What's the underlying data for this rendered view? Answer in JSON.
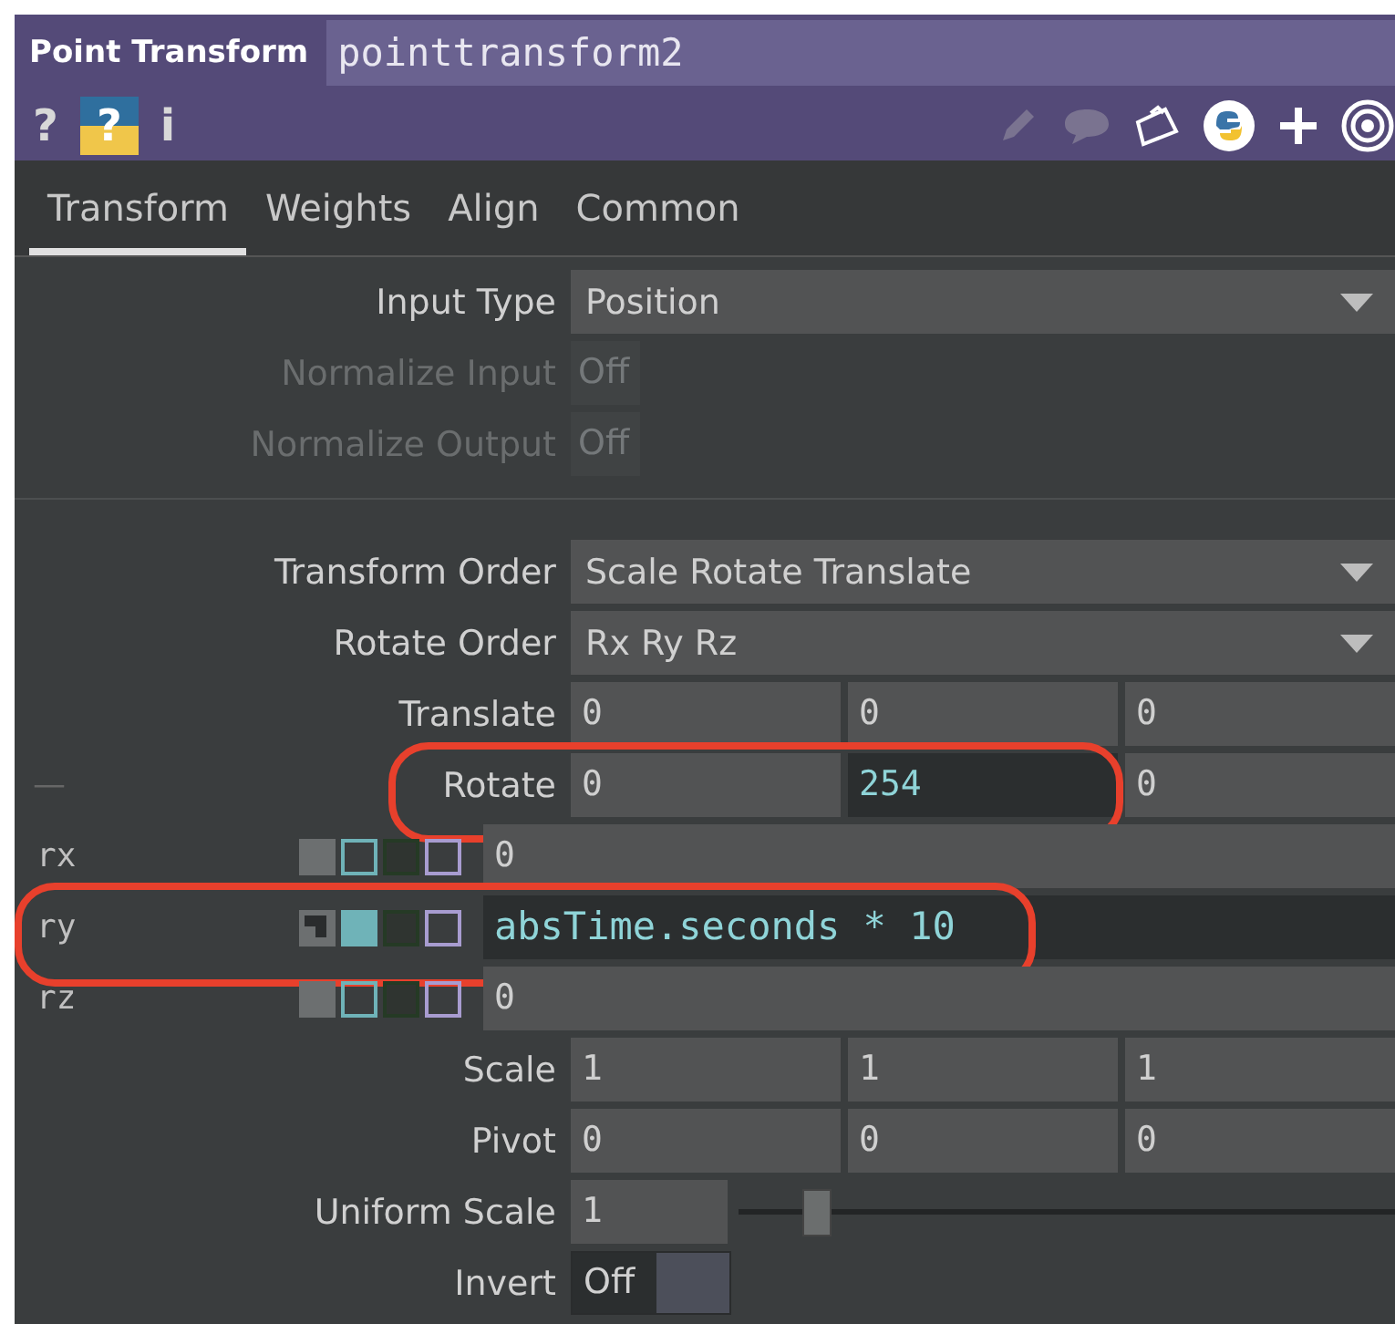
{
  "header": {
    "op_type": "Point Transform",
    "name": "pointtransform2"
  },
  "help_buttons": [
    {
      "kind": "plain",
      "label": "?"
    },
    {
      "kind": "badge",
      "label": "?"
    },
    {
      "kind": "plain",
      "label": "i"
    }
  ],
  "tabs": [
    {
      "label": "Transform",
      "selected": true
    },
    {
      "label": "Weights",
      "selected": false
    },
    {
      "label": "Align",
      "selected": false
    },
    {
      "label": "Common",
      "selected": false
    }
  ],
  "params": [
    {
      "kind": "menu",
      "label": "Input Type",
      "value": "Position"
    },
    {
      "kind": "toggle",
      "label": "Normalize Input",
      "value": "Off",
      "disabled": true
    },
    {
      "kind": "toggle",
      "label": "Normalize Output",
      "value": "Off",
      "disabled": true
    },
    {
      "kind": "separator"
    },
    {
      "kind": "menu",
      "label": "Transform Order",
      "value": "Scale Rotate Translate"
    },
    {
      "kind": "menu",
      "label": "Rotate Order",
      "value": "Rx Ry Rz"
    },
    {
      "kind": "vector",
      "label": "Translate",
      "highlighted": false,
      "values": [
        {
          "text": "0",
          "expression": false
        },
        {
          "text": "0",
          "expression": false
        },
        {
          "text": "0",
          "expression": false
        }
      ]
    },
    {
      "kind": "vector",
      "label": "Rotate",
      "side_mark": "—",
      "highlighted": true,
      "values": [
        {
          "text": "0",
          "expression": false
        },
        {
          "text": "254",
          "expression": true
        },
        {
          "text": "0",
          "expression": false
        }
      ]
    },
    {
      "kind": "channel",
      "label": "rx",
      "expression": false,
      "value": "0",
      "highlighted": false
    },
    {
      "kind": "channel",
      "label": "ry",
      "expression": true,
      "value": "absTime.seconds * 10",
      "highlighted": true
    },
    {
      "kind": "channel",
      "label": "rz",
      "expression": false,
      "value": "0",
      "highlighted": false
    },
    {
      "kind": "vector",
      "label": "Scale",
      "highlighted": false,
      "values": [
        {
          "text": "1",
          "expression": false
        },
        {
          "text": "1",
          "expression": false
        },
        {
          "text": "1",
          "expression": false
        }
      ]
    },
    {
      "kind": "vector",
      "label": "Pivot",
      "highlighted": false,
      "values": [
        {
          "text": "0",
          "expression": false
        },
        {
          "text": "0",
          "expression": false
        },
        {
          "text": "0",
          "expression": false
        }
      ]
    },
    {
      "kind": "slider",
      "label": "Uniform Scale",
      "value": "1",
      "level": 0.12
    },
    {
      "kind": "switch",
      "label": "Invert",
      "value": "Off",
      "on": false
    }
  ]
}
